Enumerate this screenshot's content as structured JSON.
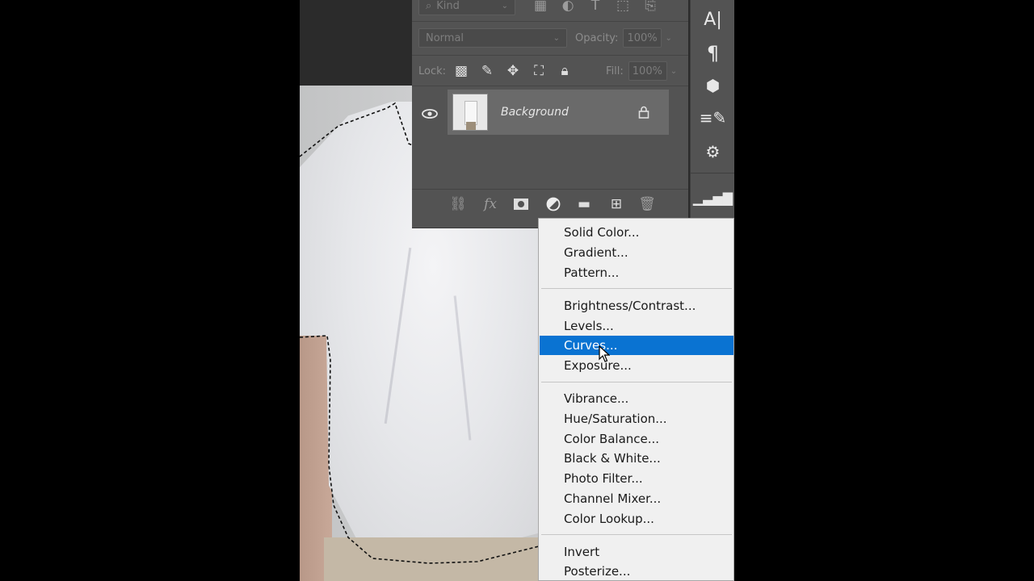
{
  "layers_panel": {
    "filter": {
      "placeholder": "Kind"
    },
    "blend_mode": "Normal",
    "opacity_label": "Opacity:",
    "opacity_value": "100%",
    "lock_label": "Lock:",
    "fill_label": "Fill:",
    "fill_value": "100%",
    "layer": {
      "name": "Background",
      "visible": true,
      "locked": true
    },
    "footer_icons": [
      "link-icon",
      "fx-icon",
      "mask-icon",
      "adjustment-layer-icon",
      "folder-icon",
      "new-layer-icon",
      "trash-icon"
    ]
  },
  "tool_strip": {
    "icons": [
      "character-icon",
      "paragraph-icon",
      "3d-icon",
      "brush-settings-icon",
      "adjustments-icon",
      "histogram-icon"
    ],
    "character_glyph": "A|",
    "paragraph_glyph": "¶"
  },
  "adjustment_menu": {
    "group1": [
      "Solid Color...",
      "Gradient...",
      "Pattern..."
    ],
    "group2": [
      "Brightness/Contrast...",
      "Levels...",
      "Curves...",
      "Exposure..."
    ],
    "group3": [
      "Vibrance...",
      "Hue/Saturation...",
      "Color Balance...",
      "Black & White...",
      "Photo Filter...",
      "Channel Mixer...",
      "Color Lookup..."
    ],
    "group4": [
      "Invert",
      "Posterize..."
    ],
    "highlighted": "Curves..."
  },
  "colors": {
    "highlight": "#0a73d2",
    "panel": "#535353",
    "menu_bg": "#f0f0f0"
  }
}
